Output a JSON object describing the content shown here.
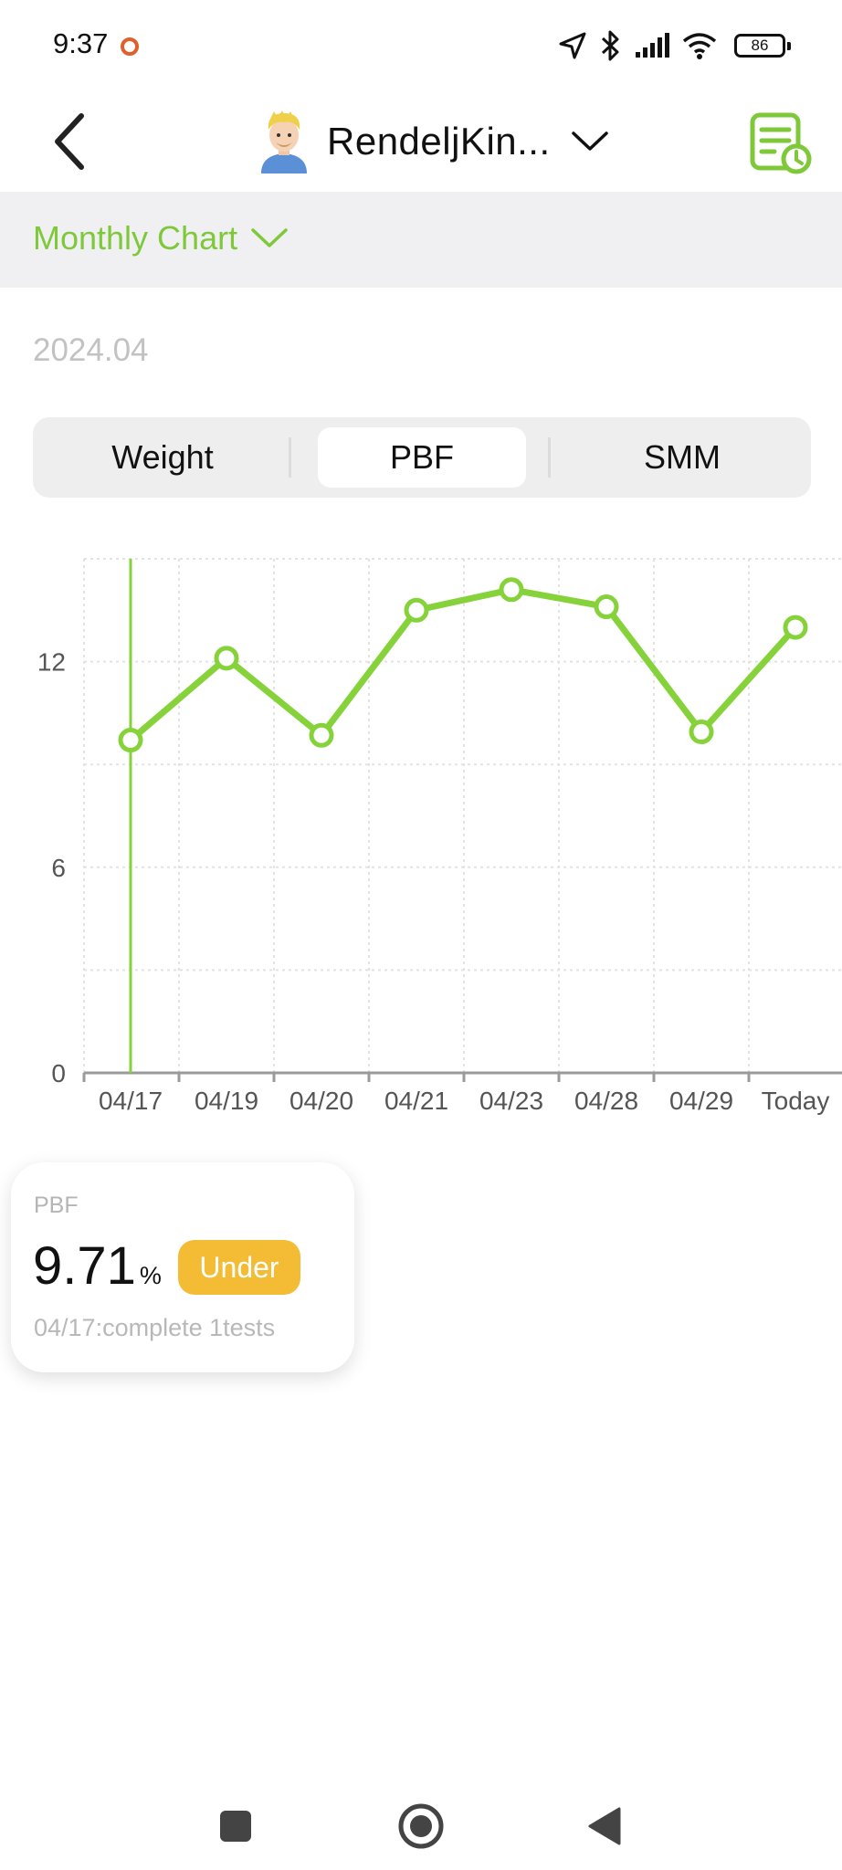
{
  "status_bar": {
    "time": "9:37",
    "battery": "86"
  },
  "header": {
    "user_name": "RendeljKin...",
    "back_icon": "chevron-left-icon",
    "report_icon": "report-history-icon"
  },
  "mode": {
    "label": "Monthly Chart"
  },
  "month": "2024.04",
  "tabs": [
    {
      "label": "Weight",
      "selected": false
    },
    {
      "label": "PBF",
      "selected": true
    },
    {
      "label": "SMM",
      "selected": false
    }
  ],
  "chart_data": {
    "type": "line",
    "categories": [
      "04/17",
      "04/19",
      "04/20",
      "04/21",
      "04/23",
      "04/28",
      "04/29",
      "Today"
    ],
    "values": [
      9.71,
      12.1,
      9.85,
      13.5,
      14.1,
      13.6,
      9.95,
      13.0
    ],
    "ytick_labels": [
      "0",
      "6",
      "12"
    ],
    "ylim": [
      0,
      15
    ],
    "highlight_index": 0,
    "grid": true,
    "line_color": "#86d23a"
  },
  "card": {
    "metric": "PBF",
    "value": "9.71",
    "unit": "%",
    "badge": "Under",
    "note": "04/17:complete 1tests"
  },
  "colors": {
    "accent": "#7ec83a",
    "badge": "#f4bc35"
  }
}
